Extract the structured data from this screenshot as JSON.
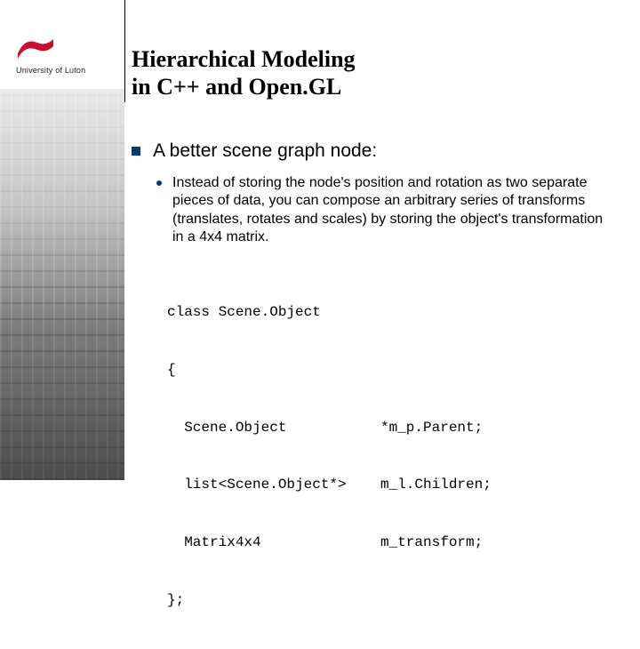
{
  "logo": {
    "text": "University of Luton"
  },
  "title": {
    "line1": "Hierarchical Modeling",
    "line2": "in C++ and Open.GL"
  },
  "content": {
    "bullet1": "A better scene graph node:",
    "bullet2": "Instead of storing the node's position and rotation as two separate pieces of data, you can compose an arbitrary series of transforms (translates, rotates and scales) by storing the object's transformation in a 4x4 matrix."
  },
  "code": {
    "l1": "class Scene.Object",
    "l2": "{",
    "r1a": "  Scene.Object",
    "r1b": "*m_p.Parent;",
    "r2a": "  list<Scene.Object*>",
    "r2b": "m_l.Children;",
    "r3a": "  Matrix4x4",
    "r3b": "m_transform;",
    "l6": "};"
  }
}
